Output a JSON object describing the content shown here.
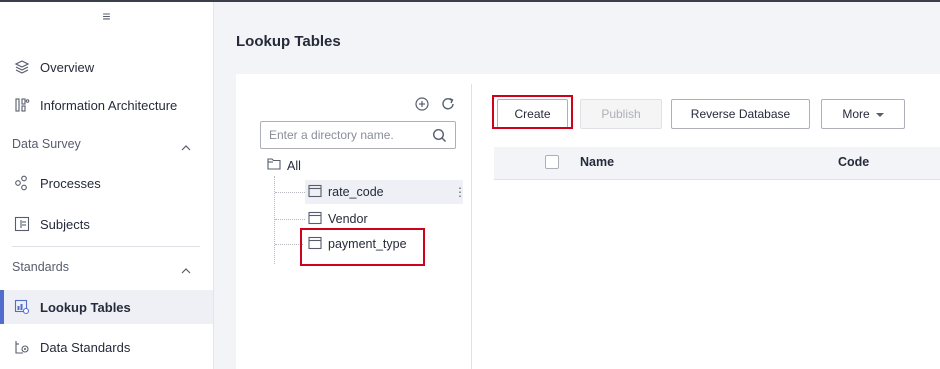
{
  "sidebar": {
    "items": [
      {
        "label": "Overview",
        "icon": "layers-icon"
      },
      {
        "label": "Information Architecture",
        "icon": "architecture-icon"
      },
      {
        "label": "Data Survey",
        "icon": "chevron-up-icon"
      },
      {
        "label": "Processes",
        "icon": "process-icon"
      },
      {
        "label": "Subjects",
        "icon": "subjects-icon"
      },
      {
        "label": "Standards",
        "icon": "chevron-up-icon"
      },
      {
        "label": "Lookup Tables",
        "icon": "lookup-table-icon"
      },
      {
        "label": "Data Standards",
        "icon": "data-standards-icon"
      }
    ]
  },
  "header": {
    "title": "Lookup Tables"
  },
  "tree": {
    "search_placeholder": "Enter a directory name.",
    "root_label": "All",
    "nodes": [
      "rate_code",
      "Vendor",
      "payment_type"
    ],
    "more_dots": "⋮"
  },
  "toolbar": {
    "create_label": "Create",
    "publish_label": "Publish",
    "reverse_label": "Reverse Database",
    "more_label": "More"
  },
  "table": {
    "columns": [
      "Name",
      "Code"
    ]
  },
  "colors": {
    "accent": "#526ecc",
    "highlight": "#d0021b"
  }
}
